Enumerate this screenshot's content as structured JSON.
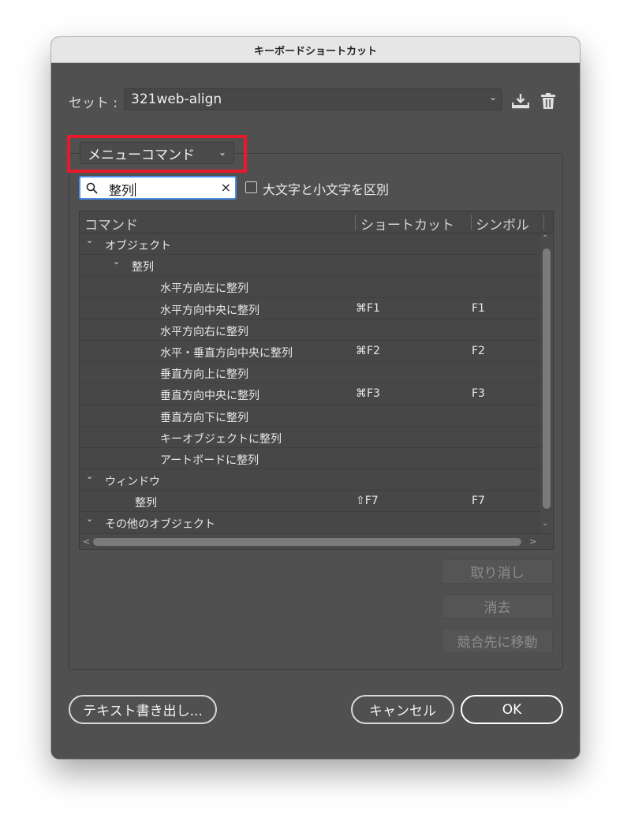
{
  "window": {
    "title": "キーボードショートカット"
  },
  "set": {
    "label": "セット :",
    "value": "321web-align",
    "chevron_icon": "chevron-down-icon",
    "save_icon": "download-save-icon",
    "delete_icon": "trash-icon"
  },
  "mode": {
    "value": "メニューコマンド",
    "chevron_icon": "chevron-down-icon"
  },
  "search": {
    "value": "整列",
    "clear": "×"
  },
  "case_option": {
    "label": "大文字と小文字を区別",
    "checked": false
  },
  "table": {
    "headers": {
      "command": "コマンド",
      "shortcut": "ショートカット",
      "symbol": "シンボル"
    },
    "rows": [
      {
        "label": "オブジェクト",
        "level": 0,
        "twisty": "⌄",
        "shortcut": "",
        "symbol": ""
      },
      {
        "label": "整列",
        "level": 1,
        "twisty": "⌄",
        "shortcut": "",
        "symbol": ""
      },
      {
        "label": "水平方向左に整列",
        "level": 2,
        "twisty": "",
        "shortcut": "",
        "symbol": ""
      },
      {
        "label": "水平方向中央に整列",
        "level": 2,
        "twisty": "",
        "shortcut": "⌘F1",
        "symbol": "F1"
      },
      {
        "label": "水平方向右に整列",
        "level": 2,
        "twisty": "",
        "shortcut": "",
        "symbol": ""
      },
      {
        "label": "水平・垂直方向中央に整列",
        "level": 2,
        "twisty": "",
        "shortcut": "⌘F2",
        "symbol": "F2"
      },
      {
        "label": "垂直方向上に整列",
        "level": 2,
        "twisty": "",
        "shortcut": "",
        "symbol": ""
      },
      {
        "label": "垂直方向中央に整列",
        "level": 2,
        "twisty": "",
        "shortcut": "⌘F3",
        "symbol": "F3"
      },
      {
        "label": "垂直方向下に整列",
        "level": 2,
        "twisty": "",
        "shortcut": "",
        "symbol": ""
      },
      {
        "label": "キーオブジェクトに整列",
        "level": 2,
        "twisty": "",
        "shortcut": "",
        "symbol": ""
      },
      {
        "label": "アートボードに整列",
        "level": 2,
        "twisty": "",
        "shortcut": "",
        "symbol": ""
      },
      {
        "label": "ウィンドウ",
        "level": 0,
        "twisty": "⌄",
        "shortcut": "",
        "symbol": ""
      },
      {
        "label": "整列",
        "level": 1.5,
        "twisty": "",
        "shortcut": "⇧F7",
        "symbol": "F7"
      },
      {
        "label": "その他のオブジェクト",
        "level": 0,
        "twisty": "⌄",
        "shortcut": "",
        "symbol": ""
      }
    ]
  },
  "actions": {
    "undo": "取り消し",
    "clear": "消去",
    "go_conflict": "競合先に移動"
  },
  "footer": {
    "export": "テキスト書き出し...",
    "cancel": "キャンセル",
    "ok": "OK"
  },
  "colors": {
    "panel": "#505050",
    "highlight": "#e8192c",
    "focus": "#4a8ce6"
  }
}
